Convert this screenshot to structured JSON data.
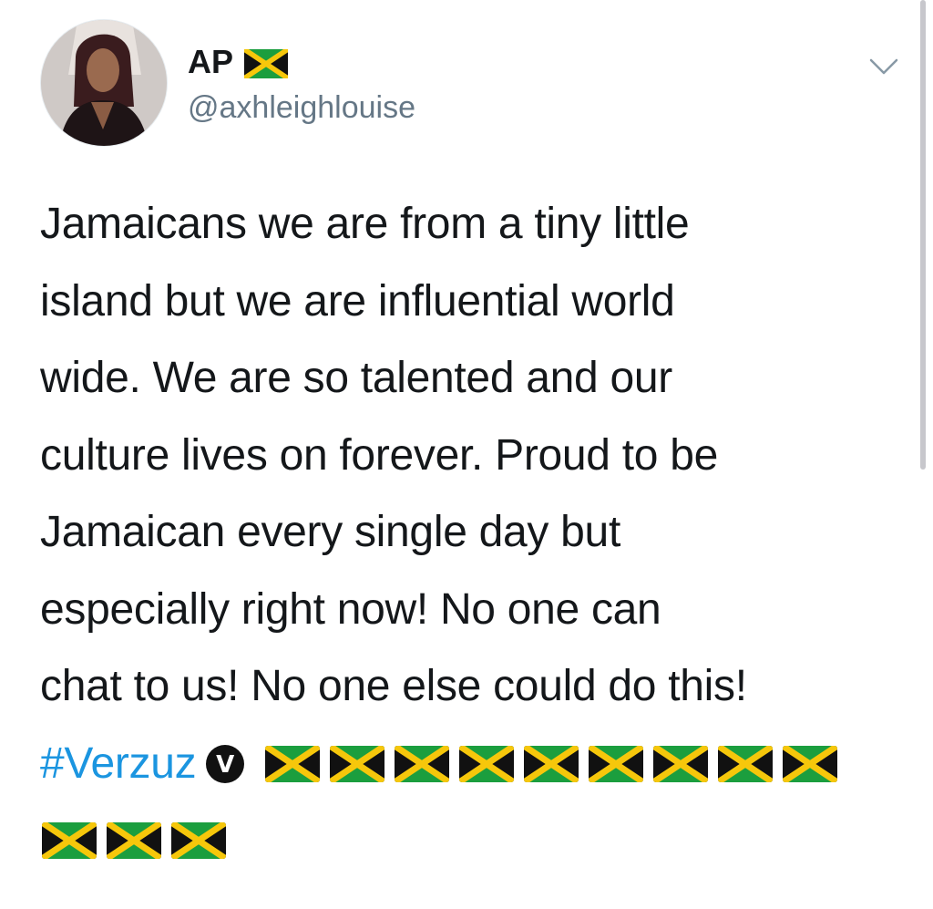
{
  "user": {
    "display_name": "AP",
    "handle": "@axhleighlouise",
    "avatar_icon": "profile-photo"
  },
  "tweet": {
    "lines": [
      "Jamaicans we are from a tiny little",
      "island but we are influential world",
      "wide. We are so talented and our",
      "culture lives on forever. Proud to be",
      "Jamaican every single day but",
      "especially right now! No one can",
      "chat to us! No one else could do this!"
    ],
    "hashtag": "#Verzuz",
    "badge_letter": "V",
    "flags_row1_count": 9,
    "flags_row2_count": 3
  },
  "icons": {
    "more": "chevron-down-icon",
    "badge": "verzuz-badge-icon",
    "flag": "jamaica-flag-icon"
  },
  "colors": {
    "text": "#14171a",
    "secondary": "#657786",
    "link": "#1b95e0",
    "flag_green": "#1b9e3e",
    "flag_gold": "#f6c70b",
    "flag_black": "#111111"
  }
}
